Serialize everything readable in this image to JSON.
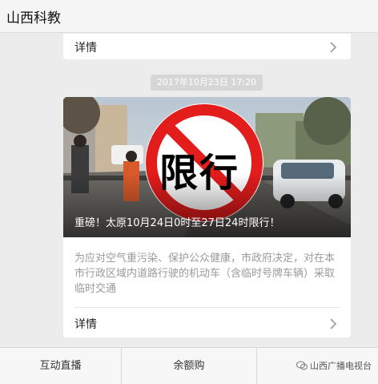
{
  "header": {
    "title": "山西科教"
  },
  "top_card": {
    "detail_label": "详情"
  },
  "timestamp": "2017年10月23日 17:20",
  "article": {
    "sign_text": "限行",
    "headline": "重磅！太原10月24日0时至27日24时限行！",
    "summary": "为应对空气重污染、保护公众健康，市政府决定，对在本市行政区域内道路行驶的机动车（含临时号牌车辆）采取临时交通",
    "detail_label": "详情"
  },
  "bottom_tabs": [
    {
      "label": "互动直播"
    },
    {
      "label": "余额购"
    },
    {
      "label": ""
    }
  ],
  "watermark": "山西广播电视台",
  "icons": {
    "chevron": "chevron-right-icon",
    "no_entry": "prohibition-icon",
    "watermark": "wechat-logo-icon"
  }
}
